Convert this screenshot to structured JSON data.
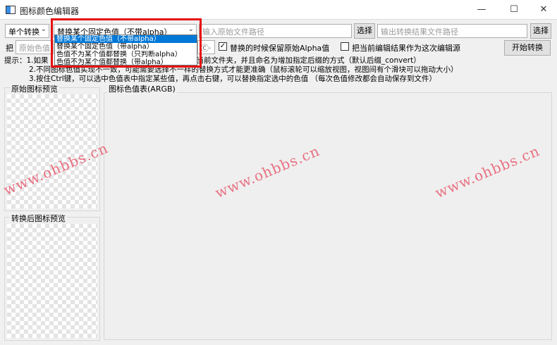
{
  "window": {
    "title": "图标颜色编辑器",
    "minimize_glyph": "—",
    "maximize_glyph": "☐",
    "close_glyph": "✕"
  },
  "toolbar": {
    "mode_combo": {
      "value": "单个转换",
      "arrow": "⌄"
    },
    "replace_combo": {
      "value": "替换某个固定色值（不带alpha）",
      "arrow": "⌄"
    },
    "dropdown_options": [
      "替换某个固定色值（不带alpha）",
      "替换某个固定色值（带alpha）",
      "色值不为某个值都替换（只判断alpha）",
      "色值不为某个值都替换（带alpha）"
    ],
    "source_path_placeholder": "输入原始文件路径",
    "source_select_label": "选择",
    "output_path_placeholder": "输出转换结果文件路径",
    "output_select_label": "选择"
  },
  "row2": {
    "ba_label": "把",
    "original_color_placeholder": "原始色值",
    "truncated_field_text": "Ⓒ·",
    "keep_alpha_checked": true,
    "keep_alpha_label": "替换的时候保留原始Alpha值",
    "use_result_checked": false,
    "use_result_label": "把当前编辑结果作为这次编辑源",
    "start_button_label": "开始转换"
  },
  "tips": {
    "line1_prefix": "提示：1.如果",
    "line1_suffix": "当前文件夹，并且命名为增加指定后缀的方式（默认后缀_convert）",
    "line2_prefix": "2.不同",
    "line2_suffix": "图标色值实现不一致，可能需要选择不一样的替换方式才能更准确（鼠标滚轮可以缩放视图，视图间有个滑块可以拖动大小）",
    "line3": "3.按住Ctrl键，可以选中色值表中指定某些值，再点击右键，可以替换指定选中的色值 （每次色值修改都会自动保存到文件）"
  },
  "panels": {
    "original_preview_title": "原始图标预览",
    "converted_preview_title": "转换后图标预览",
    "color_table_title": "图标色值表(ARGB)"
  },
  "watermark": {
    "text": "www.ohbbs.cn",
    "color": "#e85a6e"
  },
  "colors": {
    "highlight": "#e81010",
    "selection": "#0078d7"
  }
}
